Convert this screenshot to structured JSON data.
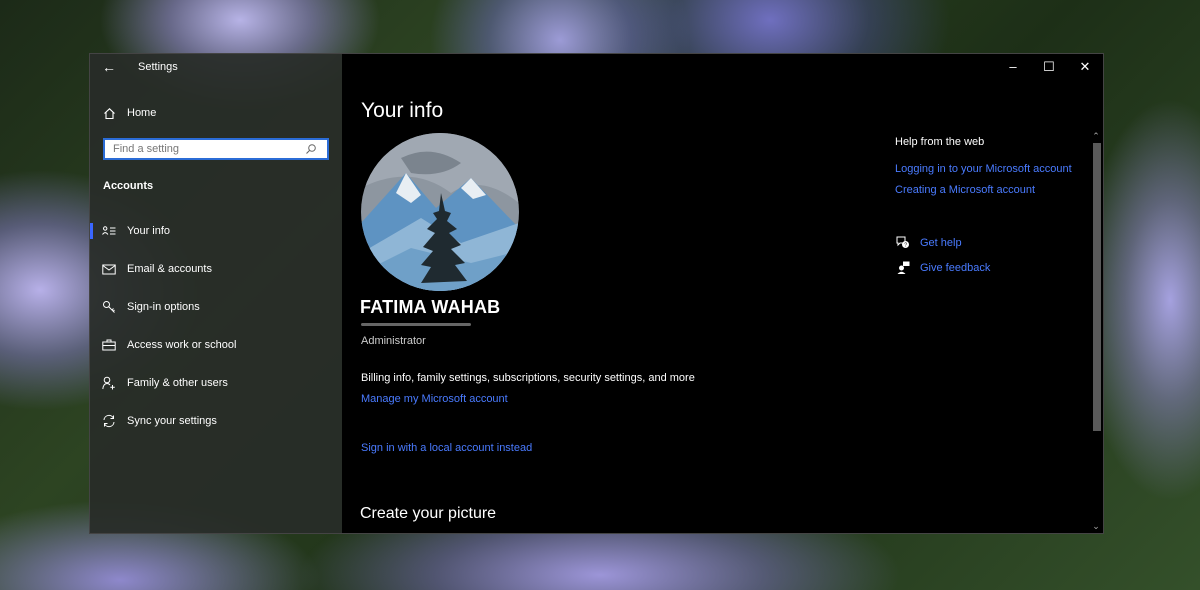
{
  "window": {
    "title": "Settings",
    "controls": {
      "minimize": "–",
      "maximize": "☐",
      "close": "✕"
    }
  },
  "sidebar": {
    "home_label": "Home",
    "search_placeholder": "Find a setting",
    "section_heading": "Accounts",
    "items": [
      {
        "label": "Your info",
        "icon": "person-card-icon",
        "selected": true
      },
      {
        "label": "Email & accounts",
        "icon": "mail-icon",
        "selected": false
      },
      {
        "label": "Sign-in options",
        "icon": "key-icon",
        "selected": false
      },
      {
        "label": "Access work or school",
        "icon": "briefcase-icon",
        "selected": false
      },
      {
        "label": "Family & other users",
        "icon": "person-add-icon",
        "selected": false
      },
      {
        "label": "Sync your settings",
        "icon": "sync-icon",
        "selected": false
      }
    ]
  },
  "main": {
    "page_title": "Your info",
    "user_name": "FATIMA WAHAB",
    "role": "Administrator",
    "billing_text": "Billing info, family settings, subscriptions, security settings, and more",
    "manage_link": "Manage my Microsoft account",
    "local_link": "Sign in with a local account instead",
    "section_title": "Create your picture"
  },
  "help": {
    "heading": "Help from the web",
    "links": [
      "Logging in to your Microsoft account",
      "Creating a Microsoft account"
    ],
    "get_help": "Get help",
    "give_feedback": "Give feedback"
  },
  "colors": {
    "accent": "#3a66ff",
    "link": "#4a7bff",
    "main_bg": "#000000",
    "sidebar_bg": "#2a2e2a"
  }
}
